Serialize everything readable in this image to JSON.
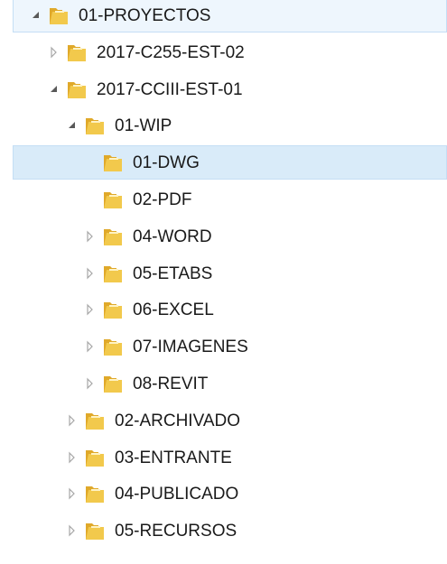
{
  "tree": {
    "items": [
      {
        "label": "01-PROYECTOS",
        "level": 0,
        "expander": "expanded",
        "selected": false,
        "focused": true
      },
      {
        "label": "2017-C255-EST-02",
        "level": 1,
        "expander": "collapsed",
        "selected": false
      },
      {
        "label": "2017-CCIII-EST-01",
        "level": 1,
        "expander": "expanded",
        "selected": false
      },
      {
        "label": "01-WIP",
        "level": 2,
        "expander": "expanded",
        "selected": false
      },
      {
        "label": "01-DWG",
        "level": 3,
        "expander": "none",
        "selected": true
      },
      {
        "label": "02-PDF",
        "level": 3,
        "expander": "none",
        "selected": false
      },
      {
        "label": "04-WORD",
        "level": 3,
        "expander": "collapsed",
        "selected": false
      },
      {
        "label": "05-ETABS",
        "level": 3,
        "expander": "collapsed",
        "selected": false
      },
      {
        "label": "06-EXCEL",
        "level": 3,
        "expander": "collapsed",
        "selected": false
      },
      {
        "label": "07-IMAGENES",
        "level": 3,
        "expander": "collapsed",
        "selected": false
      },
      {
        "label": "08-REVIT",
        "level": 3,
        "expander": "collapsed",
        "selected": false
      },
      {
        "label": "02-ARCHIVADO",
        "level": 2,
        "expander": "collapsed",
        "selected": false
      },
      {
        "label": "03-ENTRANTE",
        "level": 2,
        "expander": "collapsed",
        "selected": false
      },
      {
        "label": "04-PUBLICADO",
        "level": 2,
        "expander": "collapsed",
        "selected": false
      },
      {
        "label": "05-RECURSOS",
        "level": 2,
        "expander": "collapsed",
        "selected": false
      }
    ],
    "colors": {
      "selected_bg": "#d9ebf9",
      "folder_body": "#f2c94c",
      "folder_back": "#e0a92a",
      "expander": "#595959"
    }
  }
}
